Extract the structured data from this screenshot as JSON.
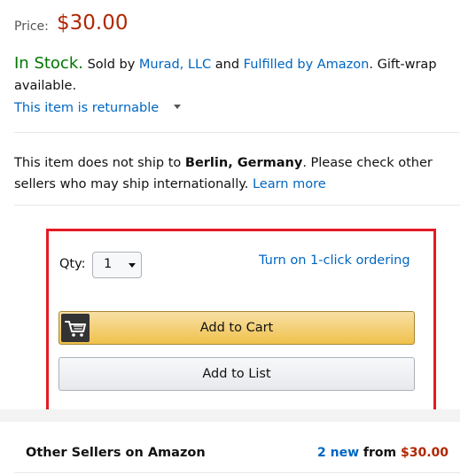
{
  "price": {
    "label": "Price:",
    "value": "$30.00"
  },
  "stock": {
    "status": "In Stock.",
    "sold_by_prefix": "Sold by",
    "seller_name": "Murad, LLC",
    "and_text": "and",
    "fulfilled_link": "Fulfilled by Amazon",
    "suffix": ". Gift-wrap available."
  },
  "returnable_link": "This item is returnable",
  "shipping": {
    "prefix": "This item does not ship to",
    "location": "Berlin, Germany",
    "suffix": ". Please check other sellers who may ship internationally.",
    "learn_more": "Learn more"
  },
  "buy_box": {
    "qty_label": "Qty:",
    "qty_value": "1",
    "one_click_link": "Turn on 1-click ordering",
    "add_to_cart": "Add to Cart",
    "add_to_list": "Add to List",
    "highlight_color": "#e31b23"
  },
  "other_sellers": {
    "title": "Other Sellers on Amazon",
    "new_count": "2 new",
    "from_text": "from",
    "from_price": "$30.00"
  },
  "icons": {
    "cart": "shopping-cart-icon",
    "qty_caret": "caret-down-icon",
    "returnable_caret": "caret-down-icon"
  }
}
